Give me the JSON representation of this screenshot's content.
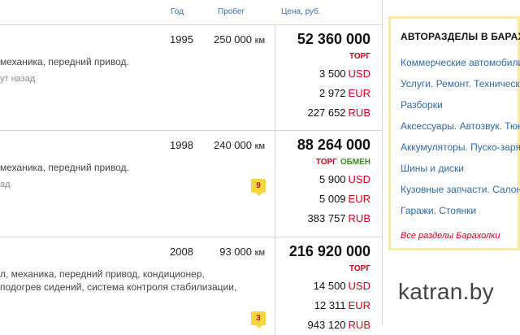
{
  "header": {
    "year": "Год",
    "mileage": "Пробег",
    "price": "Цена, руб."
  },
  "listings": [
    {
      "year": "1995",
      "mileage": "250 000",
      "mileage_unit": "км",
      "price": "52 360 000",
      "torg": "ТОРГ",
      "obmen": "",
      "desc1": "механика, передний привод.",
      "desc2": "",
      "ago": "ут назад",
      "badge": "",
      "usd": "3 500",
      "eur": "2 972",
      "rub": "227 652"
    },
    {
      "year": "1998",
      "mileage": "240 000",
      "mileage_unit": "км",
      "price": "88 264 000",
      "torg": "ТОРГ",
      "obmen": "ОБМЕН",
      "desc1": "механика, передний привод.",
      "desc2": "",
      "ago": "ад",
      "badge": "9",
      "usd": "5 900",
      "eur": "5 009",
      "rub": "383 757"
    },
    {
      "year": "2008",
      "mileage": "93 000",
      "mileage_unit": "км",
      "price": "216 920 000",
      "torg": "ТОРГ",
      "obmen": "",
      "desc1": "л, механика, передний привод, кондиционер,",
      "desc2": "подогрев сидений, система контроля стабилизации,",
      "ago": "",
      "badge": "3",
      "usd": "14 500",
      "eur": "12 311",
      "rub": "943 120"
    }
  ],
  "currency": {
    "usd": "USD",
    "eur": "EUR",
    "rub": "RUB"
  },
  "sidebar": {
    "title": "АВТОРАЗДЕЛЫ В БАРАХОЛКЕ",
    "links": [
      "Коммерческие автомобили",
      "Услуги. Ремонт. Техническое",
      "Разборки",
      "Аксессуары. Автозвук. Тюнинг",
      "Аккумуляторы. Пуско-зарядные",
      "Шины и диски",
      "Кузовные запчасти. Салон",
      "Гаражи. Стоянки"
    ],
    "all": "Все разделы Барахолки"
  },
  "logo": "katran.by",
  "colors": {
    "link": "#2d6aa7",
    "accent": "#d0021b",
    "green": "#3a8a1f",
    "badge": "#f5d63c",
    "sidebar_border": "#fbe9a3"
  }
}
